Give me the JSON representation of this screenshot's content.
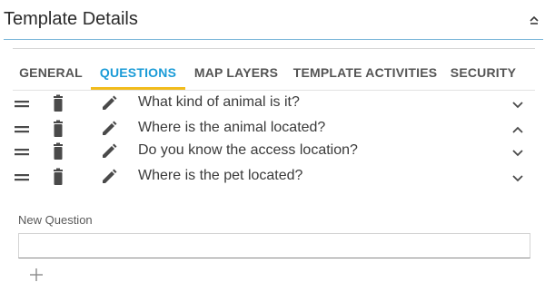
{
  "panel": {
    "title": "Template Details"
  },
  "tabs": [
    {
      "label": "GENERAL",
      "active": false
    },
    {
      "label": "QUESTIONS",
      "active": true
    },
    {
      "label": "MAP LAYERS",
      "active": false
    },
    {
      "label": "TEMPLATE ACTIVITIES",
      "active": false
    },
    {
      "label": "SECURITY",
      "active": false
    }
  ],
  "questions": [
    {
      "text": "What kind of animal is it?",
      "expanded": false
    },
    {
      "text": "Where is the animal located?",
      "expanded": true
    },
    {
      "text": "Do you know the access location?",
      "expanded": false
    },
    {
      "text": "Where is the pet located?",
      "expanded": false
    }
  ],
  "new_question": {
    "label": "New Question",
    "value": "",
    "placeholder": ""
  },
  "icons": {
    "drag": "drag-handle-icon",
    "delete": "trash-icon",
    "edit": "pencil-icon",
    "expand": "chevron-down-icon",
    "collapse": "chevron-up-icon",
    "add": "plus-icon"
  },
  "colors": {
    "accent_blue": "#1a9bd7",
    "tab_underline": "#f2bc1c",
    "icon_gray": "#4a4a4a"
  }
}
